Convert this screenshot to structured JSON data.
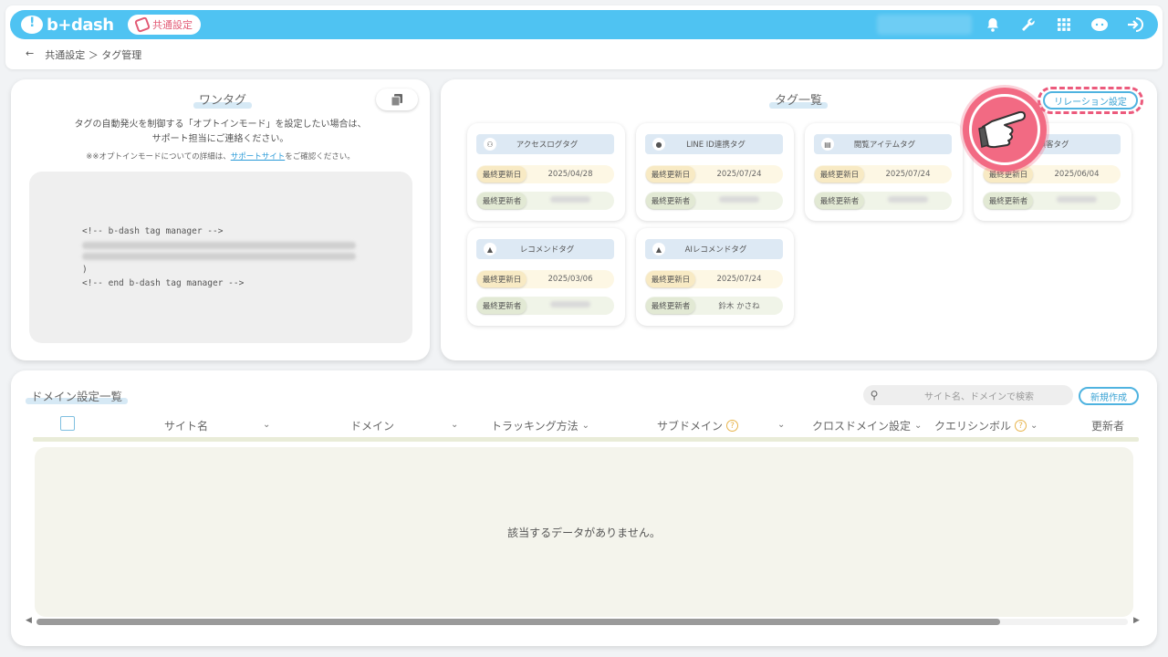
{
  "header": {
    "logo_text": "b+dash",
    "common_settings_label": "共通設定",
    "icons": [
      "bell-icon",
      "wrench-icon",
      "grid-icon",
      "support-icon",
      "logout-icon"
    ],
    "accent_color": "#4fc3f2"
  },
  "breadcrumb": {
    "back": "←",
    "path": "共通設定 ＞ タグ管理"
  },
  "onetag": {
    "title": "ワンタグ",
    "copy_icon": "copy-icon",
    "desc_line1": "タグの自動発火を制御する「オプトインモード」を設定したい場合は、",
    "desc_line2": "サポート担当にご連絡ください。",
    "note_prefix": "※※オプトインモードについての詳細は、",
    "note_link": "サポートサイト",
    "note_suffix": "をご確認ください。",
    "code_start": "<!-- b-dash tag manager -->",
    "code_end_paren": ")",
    "code_end": "<!-- end b-dash tag manager -->"
  },
  "taglist": {
    "title": "タグ一覧",
    "relation_button": "リレーション設定",
    "cards": [
      {
        "name": "アクセスログタグ",
        "icon": "users-icon",
        "date_label": "最終更新日",
        "date": "2025/04/28",
        "author_label": "最終更新者",
        "author": ""
      },
      {
        "name": "LINE ID連携タグ",
        "icon": "user-icon",
        "date_label": "最終更新日",
        "date": "2025/07/24",
        "author_label": "最終更新者",
        "author": ""
      },
      {
        "name": "閲覧アイテムタグ",
        "icon": "book-icon",
        "date_label": "最終更新日",
        "date": "2025/07/24",
        "author_label": "最終更新者",
        "author": ""
      },
      {
        "name": "顧客タグ",
        "icon": "customer-icon",
        "date_label": "最終更新日",
        "date": "2025/06/04",
        "author_label": "最終更新者",
        "author": ""
      },
      {
        "name": "レコメンドタグ",
        "icon": "thumbs-up-icon",
        "date_label": "最終更新日",
        "date": "2025/03/06",
        "author_label": "最終更新者",
        "author": ""
      },
      {
        "name": "AIレコメンドタグ",
        "icon": "thumbs-up-icon",
        "date_label": "最終更新日",
        "date": "2025/07/24",
        "author_label": "最終更新者",
        "author": "鈴木 かさね"
      }
    ]
  },
  "domain": {
    "title": "ドメイン設定一覧",
    "search_placeholder": "サイト名、ドメインで検索",
    "new_button": "新規作成",
    "columns": [
      "サイト名",
      "ドメイン",
      "トラッキング方法",
      "サブドメイン",
      "クロスドメイン設定",
      "クエリシンボル",
      "更新者"
    ],
    "empty_message": "該当するデータがありません。"
  }
}
